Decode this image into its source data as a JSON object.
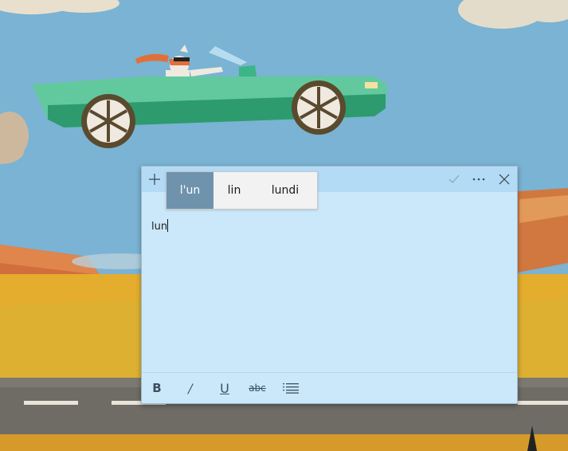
{
  "note": {
    "text": "lun",
    "titlebar_buttons": {
      "add_icon": "plus-icon",
      "check_icon": "checkmark-icon",
      "more_icon": "ellipsis-icon",
      "close_icon": "close-icon"
    },
    "toolbar": {
      "bold": "B",
      "italic": "/",
      "underline": "U",
      "strikethrough": "abc",
      "list_icon": "bullet-list-icon"
    }
  },
  "candidates": {
    "items": [
      "l'un",
      "lin",
      "lundi"
    ],
    "selected_index": 0
  },
  "colors": {
    "note_body": "#cbe8fb",
    "note_titlebar": "#b4dbf6",
    "candidate_selected": "#6f93ad",
    "sky": "#7ab3d3",
    "car": "#3cb587"
  }
}
